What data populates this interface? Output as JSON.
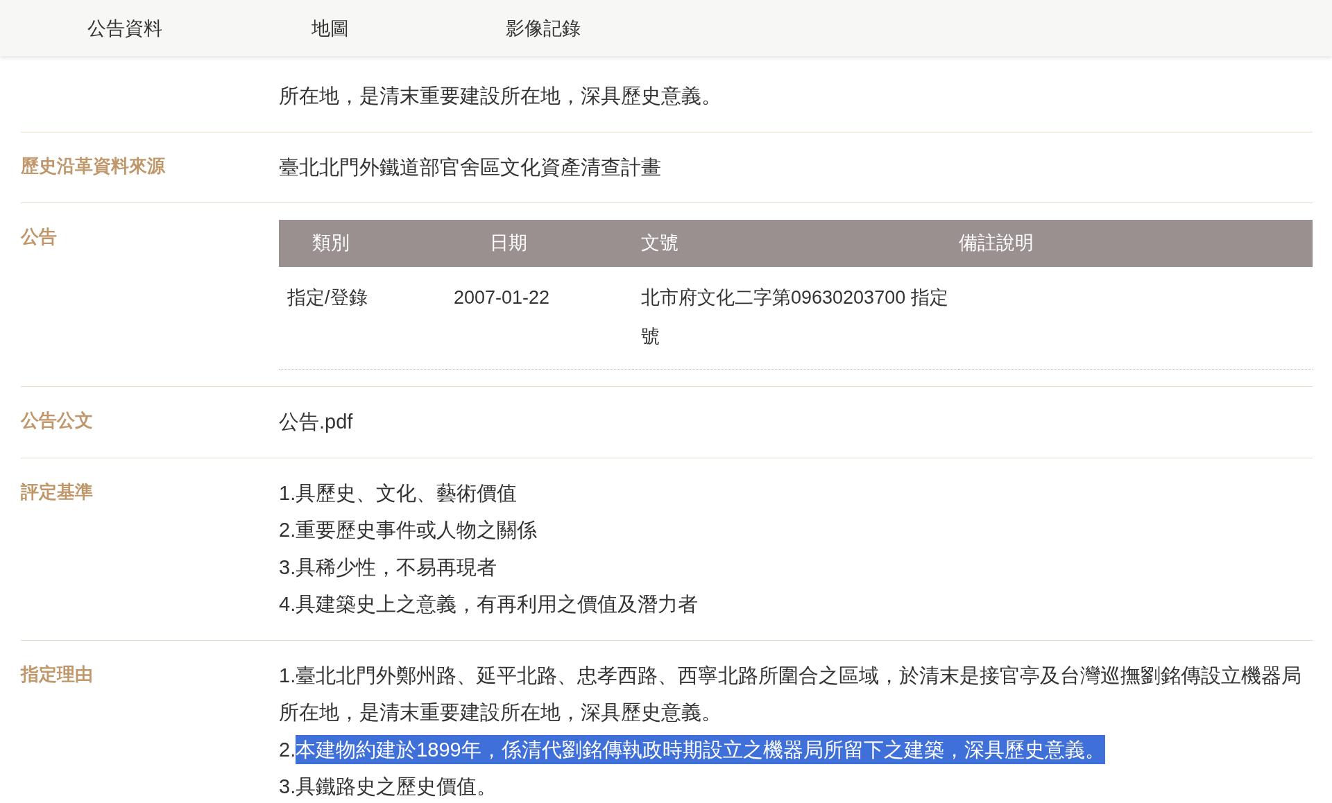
{
  "nav": [
    {
      "label": "公告資料"
    },
    {
      "label": "地圖"
    },
    {
      "label": "影像記錄"
    }
  ],
  "rows": [
    {
      "kind": "text",
      "text": "所在地，是清末重要建設所在地，深具歷史意義。"
    },
    {
      "kind": "text",
      "label": "歷史沿革資料來源",
      "text": "臺北北門外鐵道部官舍區文化資產清查計畫"
    },
    {
      "kind": "table",
      "label": "公告",
      "table": {
        "columns": [
          "類別",
          "日期",
          "文號",
          "備註說明"
        ],
        "rows": [
          {
            "cells": [
              "指定/登錄",
              "2007-01-22",
              "北市府文化二字第09630203700 指定號"
            ]
          }
        ]
      }
    },
    {
      "kind": "link",
      "label": "公告公文",
      "text": "公告.pdf"
    },
    {
      "kind": "list",
      "label": "評定基準",
      "items": [
        {
          "marker": "1.",
          "text": "具歷史、文化、藝術價值",
          "highlighted": false
        },
        {
          "marker": "2.",
          "text": "重要歷史事件或人物之關係",
          "highlighted": false
        },
        {
          "marker": "3.",
          "text": "具稀少性，不易再現者",
          "highlighted": false
        },
        {
          "marker": "4.",
          "text": "具建築史上之意義，有再利用之價值及潛力者",
          "highlighted": false
        }
      ]
    },
    {
      "kind": "list",
      "label": "指定理由",
      "items": [
        {
          "marker": "1.",
          "text": "臺北北門外鄭州路、延平北路、忠孝西路、西寧北路所圍合之區域，於清末是接官亭及台灣巡撫劉銘傳設立機器局所在地，是清末重要建設所在地，深具歷史意義。",
          "highlighted": false
        },
        {
          "marker": "2.",
          "text": "本建物約建於1899年，係清代劉銘傳執政時期設立之機器局所留下之建築，深具歷史意義。",
          "highlighted": true
        },
        {
          "marker": "3.",
          "text": "具鐵路史之歷史價值。",
          "highlighted": false
        }
      ]
    }
  ]
}
